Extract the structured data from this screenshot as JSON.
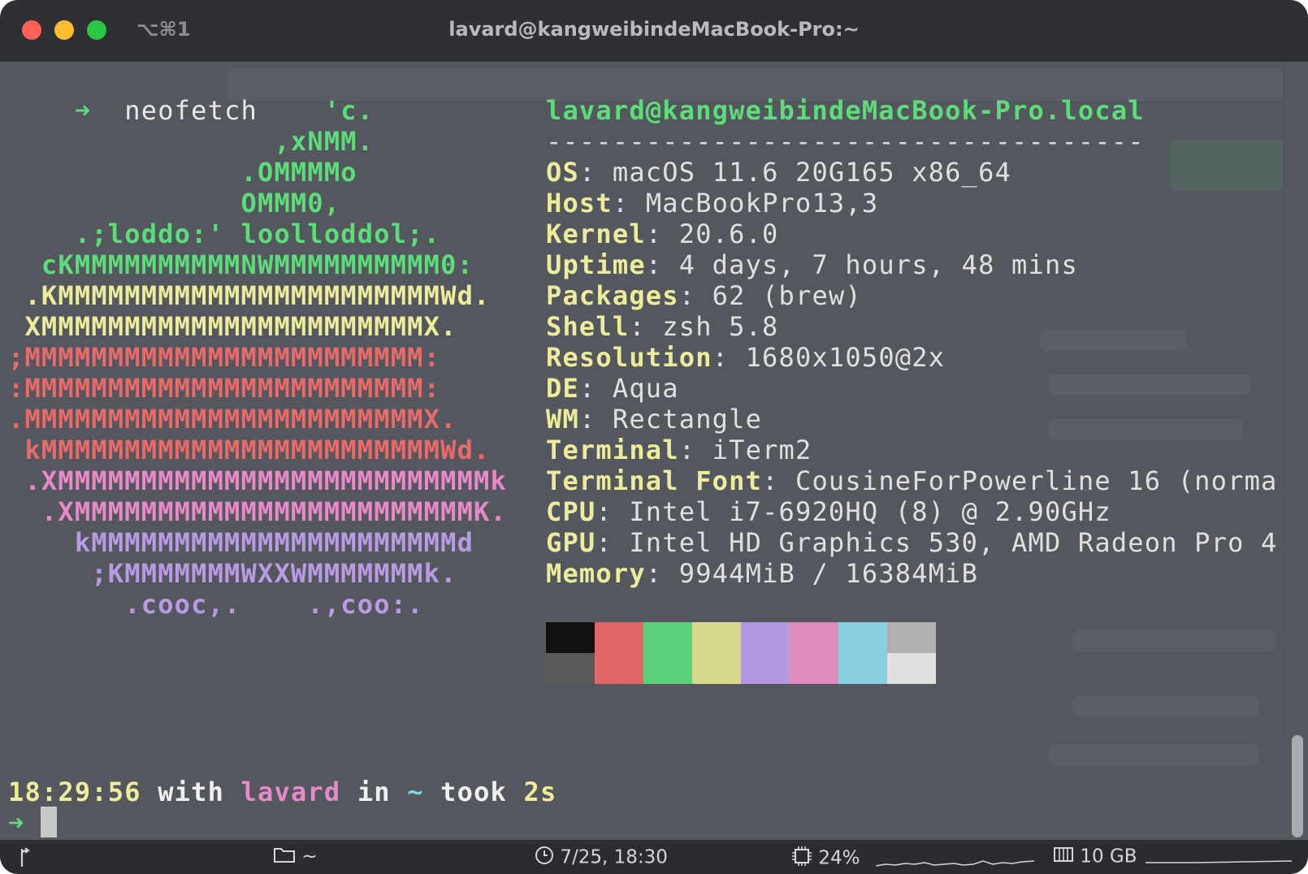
{
  "window": {
    "title": "lavard@kangweibindeMacBook-Pro:~",
    "shortcut": "⌥⌘1"
  },
  "terminal": {
    "command_prompt": "➜",
    "command": "neofetch",
    "art": [
      {
        "text": "                   'c.",
        "color": "#5ddc7a"
      },
      {
        "text": "                ,xNMM.",
        "color": "#5ddc7a"
      },
      {
        "text": "              .OMMMMo",
        "color": "#5ddc7a"
      },
      {
        "text": "              OMMM0,",
        "color": "#5ddc7a"
      },
      {
        "text": "    .;loddo:' loolloddol;.",
        "color": "#5ddc7a"
      },
      {
        "text": "  cKMMMMMMMMMMNWMMMMMMMMMM0:",
        "color": "#5ddc7a"
      },
      {
        "text": " .KMMMMMMMMMMMMMMMMMMMMMMMWd.",
        "color": "#ecec9a"
      },
      {
        "text": " XMMMMMMMMMMMMMMMMMMMMMMMX.",
        "color": "#ecec9a"
      },
      {
        "text": ";MMMMMMMMMMMMMMMMMMMMMMMM:",
        "color": "#ea6a6a"
      },
      {
        "text": ":MMMMMMMMMMMMMMMMMMMMMMMM:",
        "color": "#ea6a6a"
      },
      {
        "text": ".MMMMMMMMMMMMMMMMMMMMMMMMX.",
        "color": "#ea6a6a"
      },
      {
        "text": " kMMMMMMMMMMMMMMMMMMMMMMMMWd.",
        "color": "#ea6a6a"
      },
      {
        "text": " .XMMMMMMMMMMMMMMMMMMMMMMMMMMk",
        "color": "#e889c9"
      },
      {
        "text": "  .XMMMMMMMMMMMMMMMMMMMMMMMMK.",
        "color": "#e889c9"
      },
      {
        "text": "    kMMMMMMMMMMMMMMMMMMMMMMd",
        "color": "#b89be3"
      },
      {
        "text": "     ;KMMMMMMMWXXWMMMMMMMk.",
        "color": "#b89be3"
      },
      {
        "text": "       .cooc,.    .,coo:.",
        "color": "#b89be3"
      }
    ],
    "user_host": "lavard@kangweibindeMacBook-Pro.local",
    "separator": "------------------------------------",
    "info": [
      {
        "label": "OS",
        "value": "macOS 11.6 20G165 x86_64"
      },
      {
        "label": "Host",
        "value": "MacBookPro13,3"
      },
      {
        "label": "Kernel",
        "value": "20.6.0"
      },
      {
        "label": "Uptime",
        "value": "4 days, 7 hours, 48 mins"
      },
      {
        "label": "Packages",
        "value": "62 (brew)"
      },
      {
        "label": "Shell",
        "value": "zsh 5.8"
      },
      {
        "label": "Resolution",
        "value": "1680x1050@2x"
      },
      {
        "label": "DE",
        "value": "Aqua"
      },
      {
        "label": "WM",
        "value": "Rectangle"
      },
      {
        "label": "Terminal",
        "value": "iTerm2"
      },
      {
        "label": "Terminal Font",
        "value": "CousineForPowerline 16 (norma"
      },
      {
        "label": "CPU",
        "value": "Intel i7-6920HQ (8) @ 2.90GHz"
      },
      {
        "label": "GPU",
        "value": "Intel HD Graphics 530, AMD Radeon Pro 4"
      },
      {
        "label": "Memory",
        "value": "9944MiB / 16384MiB"
      }
    ],
    "palette_top": [
      "#121212",
      "#e06767",
      "#5ad17a",
      "#d5d98c",
      "#b39ae0",
      "#e08bc0",
      "#8acfe0",
      "#b0b0b0"
    ],
    "palette_bottom": [
      "#5a5a5a",
      "#e06767",
      "#5ad17a",
      "#d5d98c",
      "#b39ae0",
      "#e08bc0",
      "#8acfe0",
      "#e0e0e0"
    ],
    "status_line": {
      "time": "18:29:56",
      "with": "with",
      "user": "lavard",
      "in": "in",
      "dir": "~",
      "took": "took",
      "duration": "2s"
    },
    "next_prompt": "➜"
  },
  "statusbar": {
    "folder": "~",
    "clock": "7/25, 18:30",
    "cpu": "24%",
    "memory": "10 GB"
  },
  "colors": {
    "green": "#5ddc7a",
    "yellow": "#ecec9a",
    "red": "#ea6a6a",
    "pink": "#e889c9",
    "purple": "#b89be3",
    "cyan": "#7fd3e8"
  },
  "icons": [
    "git-branch-icon",
    "folder-icon",
    "clock-icon",
    "cpu-icon",
    "memory-icon"
  ]
}
